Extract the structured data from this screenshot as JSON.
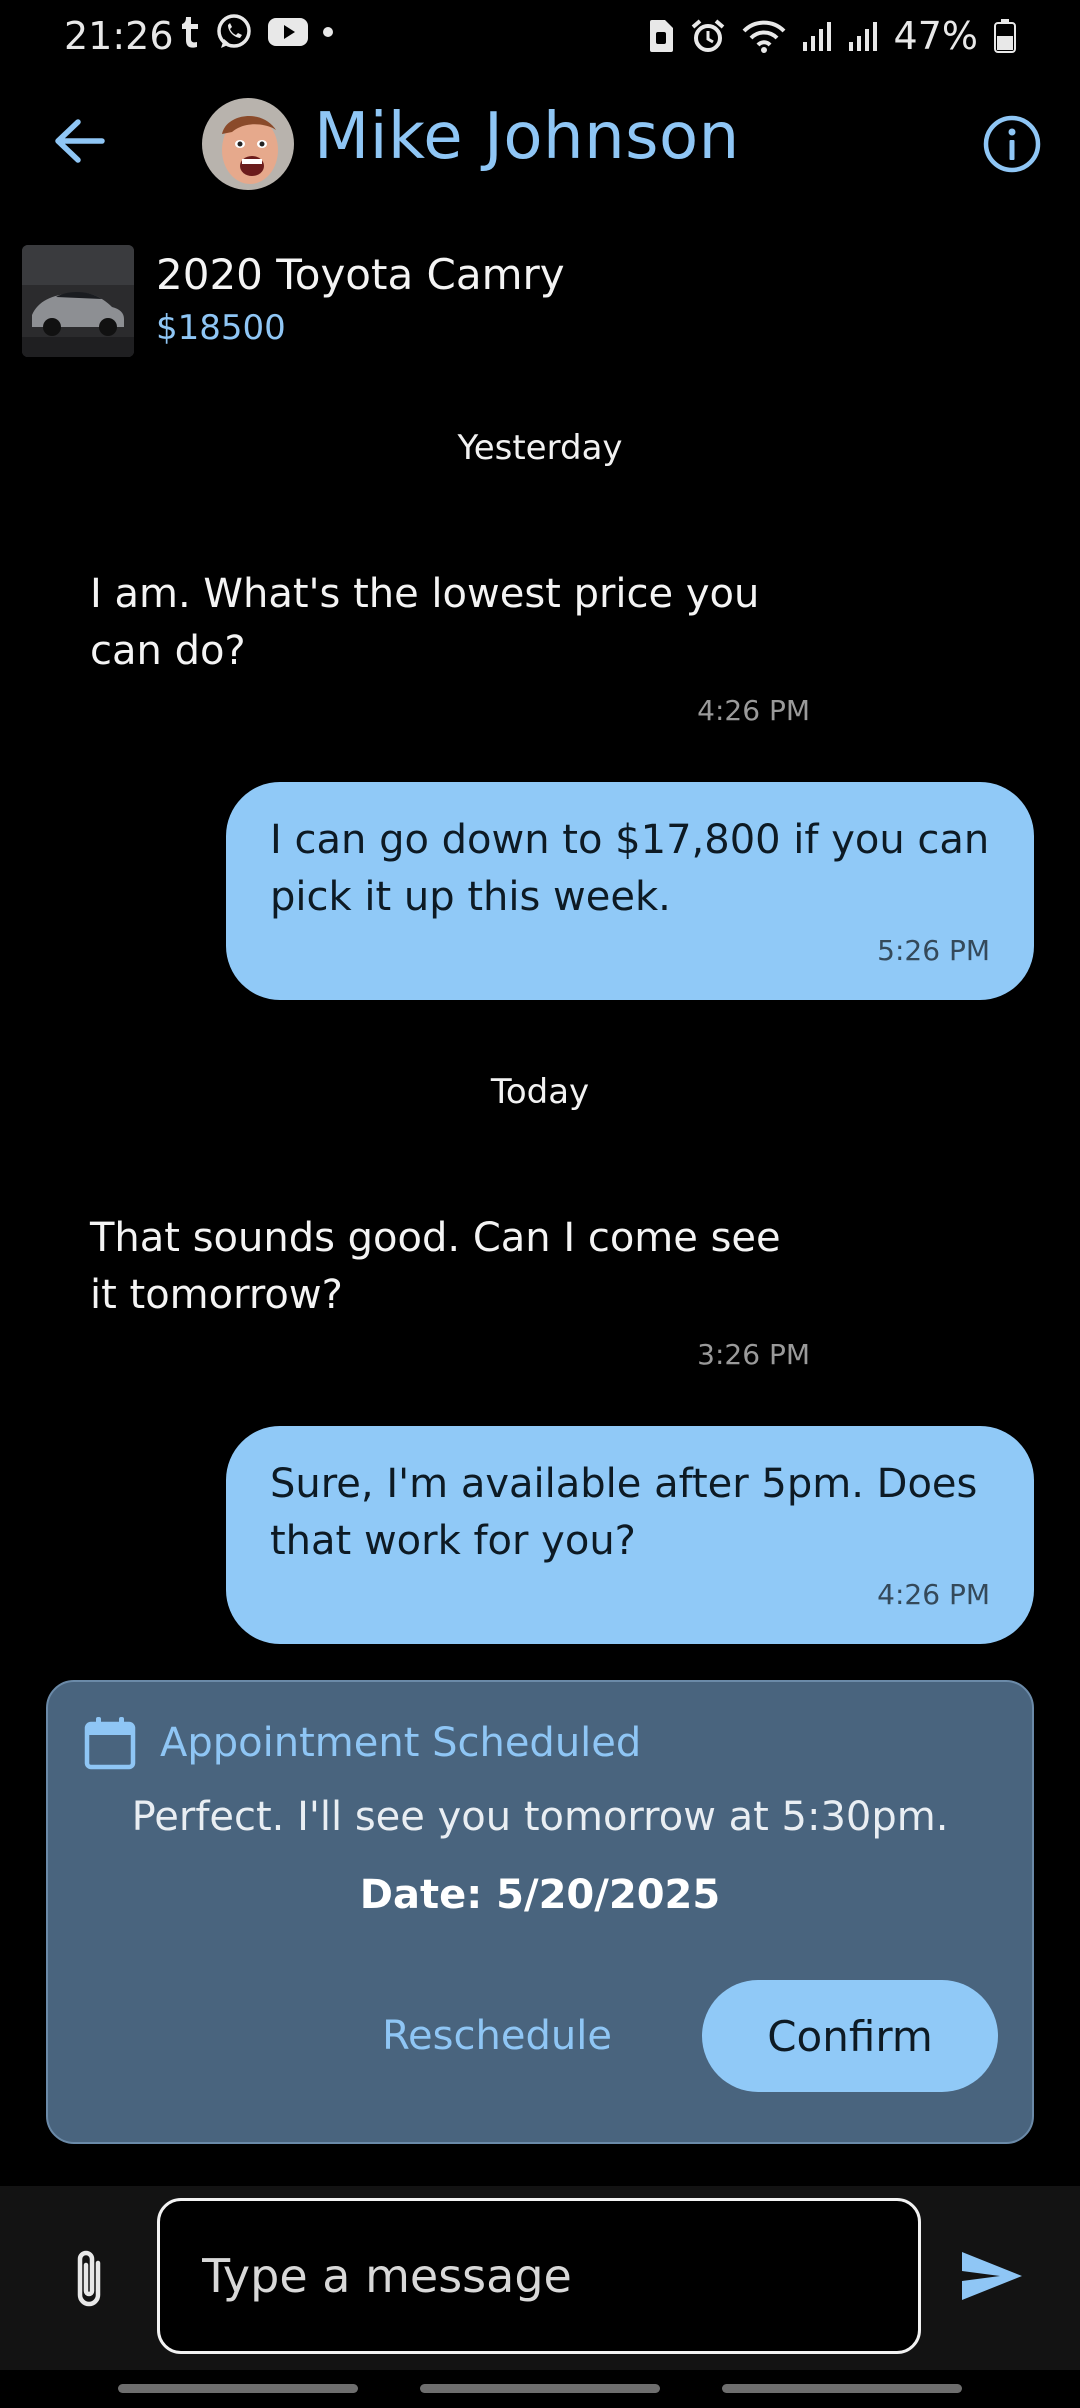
{
  "status_bar": {
    "time": "21:26",
    "battery": "47%",
    "left_icons": [
      "tumblr-icon",
      "whatsapp-icon",
      "youtube-icon",
      "dot-icon"
    ],
    "right_icons": [
      "sim-icon",
      "alarm-icon",
      "wifi-icon",
      "signal-icon",
      "signal-icon",
      "battery-icon"
    ]
  },
  "header": {
    "contact_name": "Mike Johnson",
    "back_icon": "arrow-left-icon",
    "info_icon": "info-icon"
  },
  "listing": {
    "title": "2020 Toyota Camry",
    "price": "$18500"
  },
  "conversation": {
    "groups": [
      {
        "date": "Yesterday",
        "messages": [
          {
            "direction": "incoming",
            "text": "I am. What's the lowest price you can do?",
            "time": "4:26 PM"
          },
          {
            "direction": "outgoing",
            "text": "I can go down to $17,800 if you can pick it up this week.",
            "time": "5:26 PM"
          }
        ]
      },
      {
        "date": "Today",
        "messages": [
          {
            "direction": "incoming",
            "text": "That sounds good. Can I come see it tomorrow?",
            "time": "3:26 PM"
          },
          {
            "direction": "outgoing",
            "text": "Sure, I'm available after 5pm. Does that work for you?",
            "time": "4:26 PM"
          }
        ]
      }
    ]
  },
  "appointment": {
    "title": "Appointment Scheduled",
    "message": "Perfect. I'll see you tomorrow at 5:30pm.",
    "date": "Date: 5/20/2025",
    "reschedule_label": "Reschedule",
    "confirm_label": "Confirm"
  },
  "composer": {
    "placeholder": "Type a message",
    "value": ""
  },
  "colors": {
    "accent": "#8fc6f5",
    "bubble_out": "#90c9f7",
    "card_bg": "#49647e",
    "background": "#000000"
  }
}
